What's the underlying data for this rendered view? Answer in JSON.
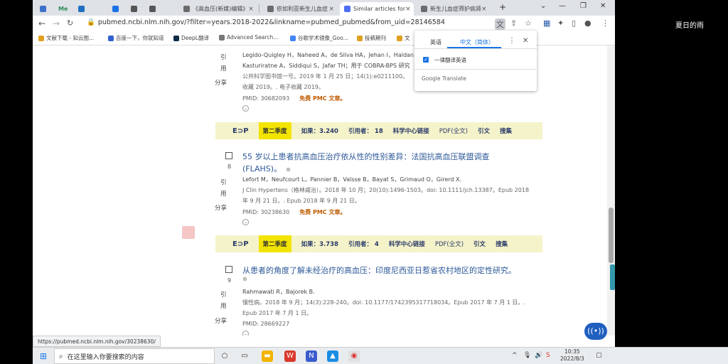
{
  "desktop": {
    "right_title": "夏日的雨"
  },
  "tabs": [
    {
      "label": "",
      "color": "#3c73c8"
    },
    {
      "label": "Me",
      "color": "#2e8b57"
    },
    {
      "label": "",
      "color": "#1f6fbf"
    },
    {
      "label": "",
      "color": "#1a73e8"
    },
    {
      "label": "",
      "color": "#555555"
    },
    {
      "label": "",
      "color": "#555555"
    },
    {
      "label": "《高血压(新媒)编辑》",
      "color": "#6b6b6b"
    },
    {
      "label": "依如利亚新生儿血症",
      "color": "#6b6b6b"
    },
    {
      "label": "Similar articles for",
      "color": "#4c6ef5",
      "active": true
    },
    {
      "label": "新生儿血症筛护病肾",
      "color": "#6b6b6b"
    }
  ],
  "toolbar": {
    "url": "pubmed.ncbi.nlm.nih.gov/?filter=years.2018-2022&linkname=pubmed_pubmed&from_uid=28146584"
  },
  "bookmarks": [
    {
      "label": "文献下载 - 知云图...",
      "color": "#e0a020"
    },
    {
      "label": "百度一下，你就知道",
      "color": "#3060d0"
    },
    {
      "label": "DeepL翻译",
      "color": "#0f2b46"
    },
    {
      "label": "Advanced Search...",
      "color": "#777777"
    },
    {
      "label": "谷歌学术镜像_Goo...",
      "color": "#4285f4"
    },
    {
      "label": "投稿期刊",
      "color": "#e0a020"
    },
    {
      "label": "文",
      "color": "#e0a020"
    }
  ],
  "translate_popup": {
    "tab_en": "英语",
    "tab_zh": "中文（简体）",
    "always_label": "一律翻译英语",
    "brand": "Google Translate"
  },
  "articles": [
    {
      "number": "",
      "authors": "Legido-Quigley H，Naheed A，de Silva HA，Jehan I，Haldan",
      "authors2": "Kasturiratne A，Siddiqui S，Jafar TH；用于 COBRA-BPS 研究",
      "journal": "公共科学图书馆一号。2019 年 1 月 25 日；14(1):e0211100。",
      "epub": "收藏 2019。. 电子收藏 2019。",
      "pmid": "PMID: 30682093",
      "pmc": "免费 PMC 文章。",
      "side": [
        "引",
        "用",
        "分享"
      ]
    },
    {
      "number": "8",
      "title": "55 岁以上患者抗高血压治疗依从性的性别差异：法国抗高血压联盟调查",
      "title2": "(FLAHS)。",
      "authors": "Lefort M，Neufcourt L，Pannier B，Vaïsse B，Bayat S，Grimaud O，Girerd X.",
      "journal": "J Clin Hypertens（格林威治）。2018 年 10 月；20(10):1496-1503。doi: 10.1111/jch.13387。Epub 2018",
      "epub": "年 9 月 21 日。. Epub 2018 年 9 月 21 日。",
      "pmid": "PMID: 30238630",
      "pmc": "免费 PMC 文章。",
      "side": [
        "引",
        "用",
        "分享"
      ]
    },
    {
      "number": "9",
      "title": "从患者的角度了解未经治疗的高血压：印度尼西亚日惹省农村地区的定性研究。",
      "authors": "Rahmawati R，Bajorek B.",
      "journal": "慢性病。2018 年 9 月；14(3):228-240。doi: 10.1177/1742395317718034。Epub 2017 年 7 月 1 日。.",
      "epub": "Epub 2017 年 7 月 1 日。",
      "pmid": "PMID: 28669227",
      "side": [
        "引",
        "用",
        "分享"
      ]
    }
  ],
  "bars": [
    {
      "ep": "E⊃P",
      "quarter": "第二季度",
      "if": "如果：3.240",
      "cited": "引用者：  18",
      "link": "科学中心链接",
      "pdf": "PDF(全文)",
      "cite": "引文",
      "search": "搜集"
    },
    {
      "ep": "E⊃P",
      "quarter": "第二季度",
      "if": "如果：3.738",
      "cited": "引用者：  4",
      "link": "科学中心链接",
      "pdf": "PDF(全文)",
      "cite": "引文",
      "search": "搜集"
    }
  ],
  "statusbar": {
    "url": "https://pubmed.ncbi.nlm.nih.gov/30238630/"
  },
  "taskbar": {
    "search_placeholder": "在这里输入你要搜索的内容",
    "time": "10:35",
    "date": "2022/8/3"
  }
}
